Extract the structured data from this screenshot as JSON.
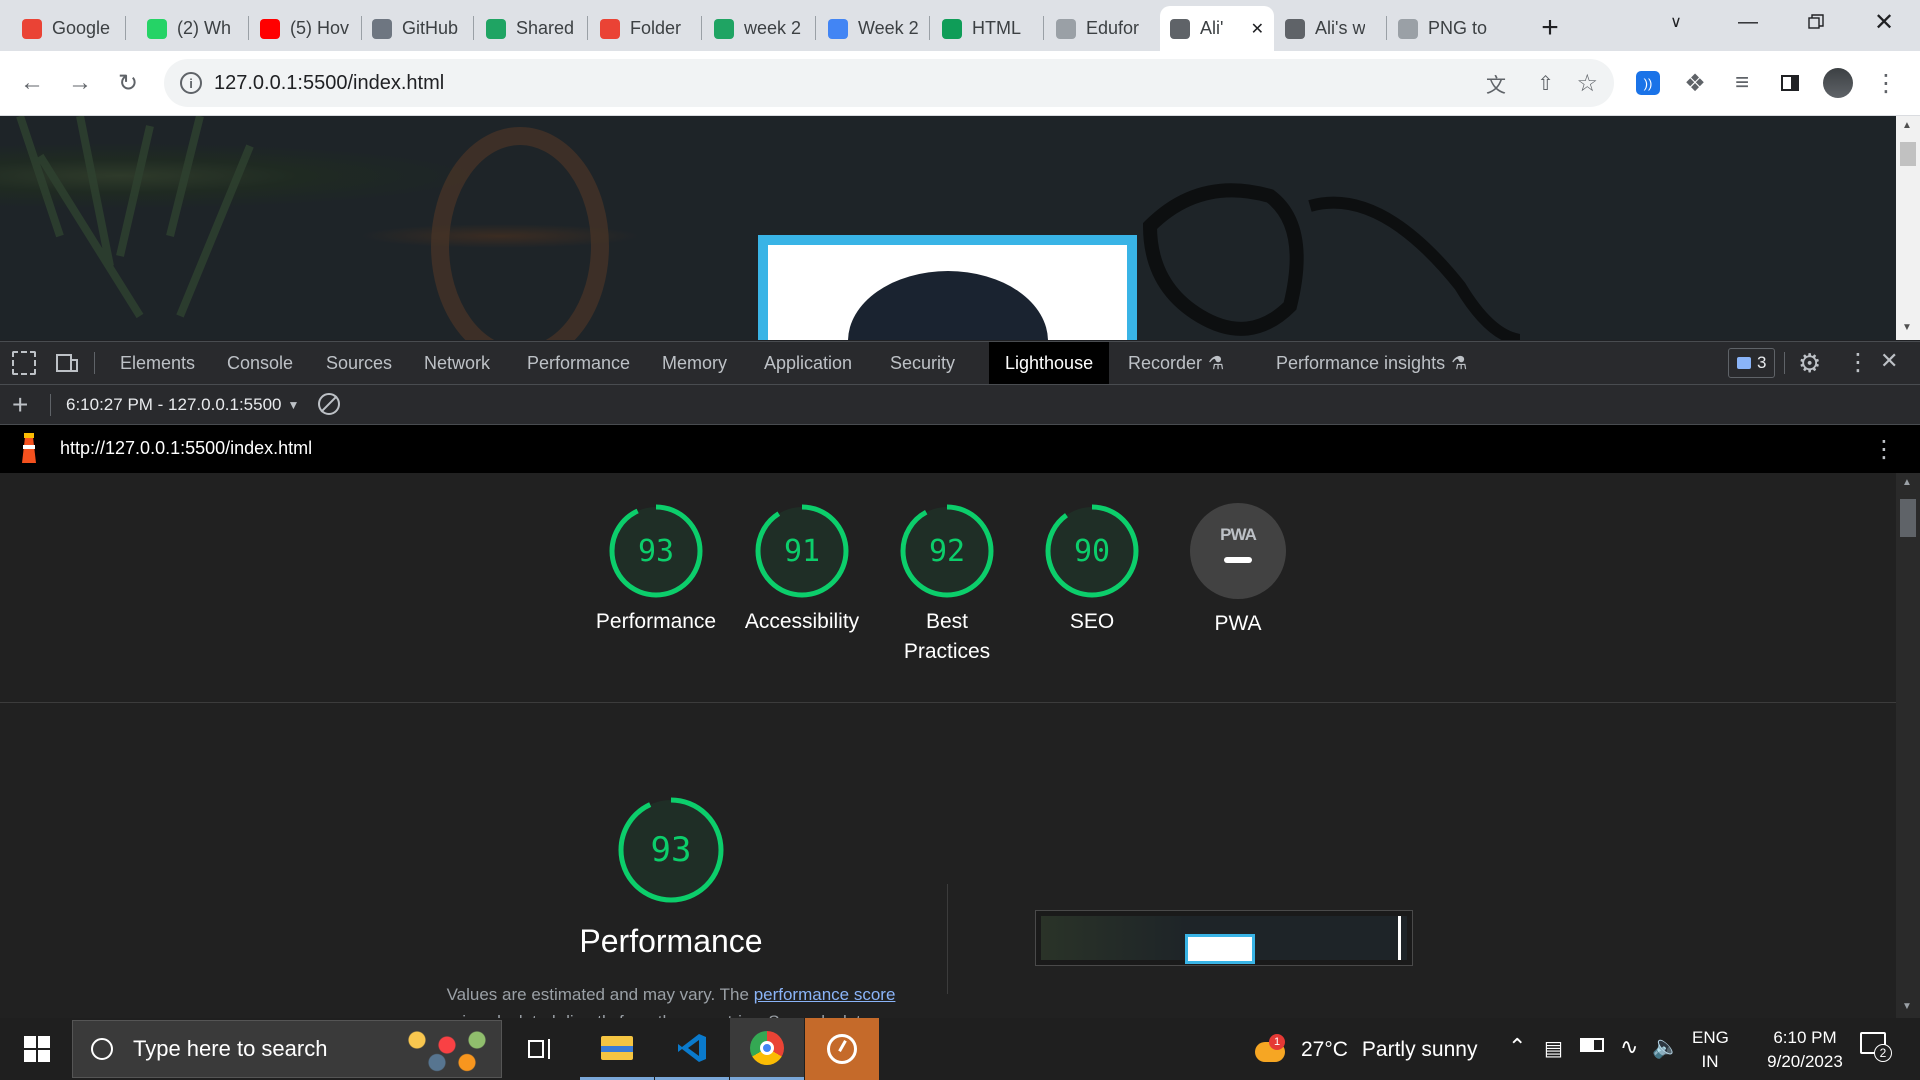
{
  "browser": {
    "tabs": [
      {
        "title": "Google",
        "icon": "gmail-icon",
        "color": "#ea4335"
      },
      {
        "title": "(2) Wh",
        "icon": "whatsapp-icon",
        "color": "#25d366"
      },
      {
        "title": "(5) Hov",
        "icon": "youtube-icon",
        "color": "#ff0000"
      },
      {
        "title": "GitHub",
        "icon": "github-icon",
        "color": "#6e7681"
      },
      {
        "title": "Shared",
        "icon": "drive-icon",
        "color": "#1fa463"
      },
      {
        "title": "Folder",
        "icon": "gmail-icon",
        "color": "#ea4335"
      },
      {
        "title": "week 2",
        "icon": "drive-icon",
        "color": "#1fa463"
      },
      {
        "title": "Week 2",
        "icon": "docs-icon",
        "color": "#4285f4"
      },
      {
        "title": "HTML",
        "icon": "plus-site-icon",
        "color": "#0f9d58"
      },
      {
        "title": "Edufor",
        "icon": "site-icon",
        "color": "#9aa0a6"
      },
      {
        "title": "Ali'",
        "icon": "avatar-icon",
        "color": "#5f6368"
      },
      {
        "title": "Ali's w",
        "icon": "avatar-icon",
        "color": "#5f6368"
      },
      {
        "title": "PNG to",
        "icon": "site-icon",
        "color": "#9aa0a6"
      }
    ],
    "active_tab_index": 10,
    "new_tab": "+",
    "url": "127.0.0.1:5500/index.html"
  },
  "devtools": {
    "tabs": [
      "Elements",
      "Console",
      "Sources",
      "Network",
      "Performance",
      "Memory",
      "Application",
      "Security",
      "Lighthouse",
      "Recorder",
      "Performance insights"
    ],
    "active_tab": "Lighthouse",
    "issues_count": "3",
    "report_select": "6:10:27 PM - 127.0.0.1:5500",
    "lighthouse_url": "http://127.0.0.1:5500/index.html"
  },
  "lighthouse": {
    "gauges": [
      {
        "score": "93",
        "label": "Performance",
        "fraction": 0.93
      },
      {
        "score": "91",
        "label": "Accessibility",
        "fraction": 0.91
      },
      {
        "score": "92",
        "label": "Best Practices",
        "fraction": 0.92
      },
      {
        "score": "90",
        "label": "SEO",
        "fraction": 0.9
      },
      {
        "score": "",
        "label": "PWA",
        "badge": "PWA"
      }
    ],
    "main_score": "93",
    "main_fraction": 0.93,
    "main_title": "Performance",
    "desc_text": "Values are estimated and may vary. The ",
    "desc_link": "performance score",
    "desc_cut": "is calculated directly from these metrics. See calculator.",
    "pass_color": "#0cce6b"
  },
  "taskbar": {
    "search_placeholder": "Type here to search",
    "weather_temp": "27°C",
    "weather_text": "Partly sunny",
    "weather_badge": "1",
    "lang_top": "ENG",
    "lang_bottom": "IN",
    "time": "6:10 PM",
    "date": "9/20/2023",
    "notif_count": "2"
  }
}
